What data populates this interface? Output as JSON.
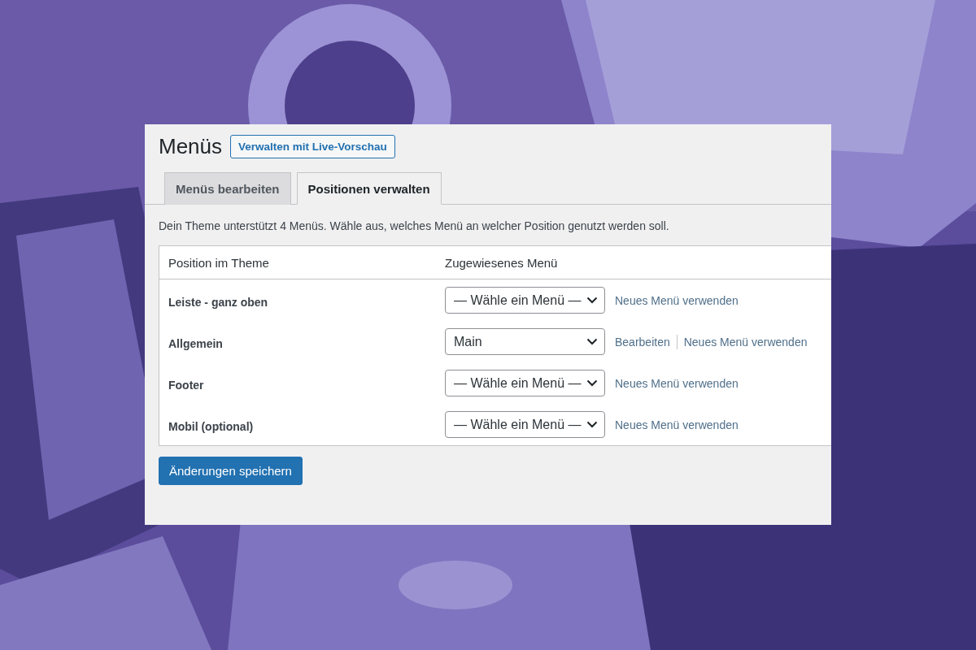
{
  "page": {
    "title": "Menüs",
    "preview_button": "Verwalten mit Live-Vorschau"
  },
  "tabs": [
    {
      "label": "Menüs bearbeiten",
      "selected": false
    },
    {
      "label": "Positionen verwalten",
      "selected": true
    }
  ],
  "description": "Dein Theme unterstützt 4 Menüs. Wähle aus, welches Menü an welcher Position genutzt werden soll.",
  "table": {
    "columns": [
      "Position im Theme",
      "Zugewiesenes Menü"
    ],
    "rows": [
      {
        "position": "Leiste - ganz oben",
        "menu": "— Wähle ein Menü —",
        "links": [
          "Neues Menü verwenden"
        ]
      },
      {
        "position": "Allgemein",
        "menu": "Main",
        "links": [
          "Bearbeiten",
          "Neues Menü verwenden"
        ]
      },
      {
        "position": "Footer",
        "menu": "— Wähle ein Menü —",
        "links": [
          "Neues Menü verwenden"
        ]
      },
      {
        "position": "Mobil (optional)",
        "menu": "— Wähle ein Menü —",
        "links": [
          "Neues Menü verwenden"
        ]
      }
    ]
  },
  "save_button": "Änderungen speichern"
}
